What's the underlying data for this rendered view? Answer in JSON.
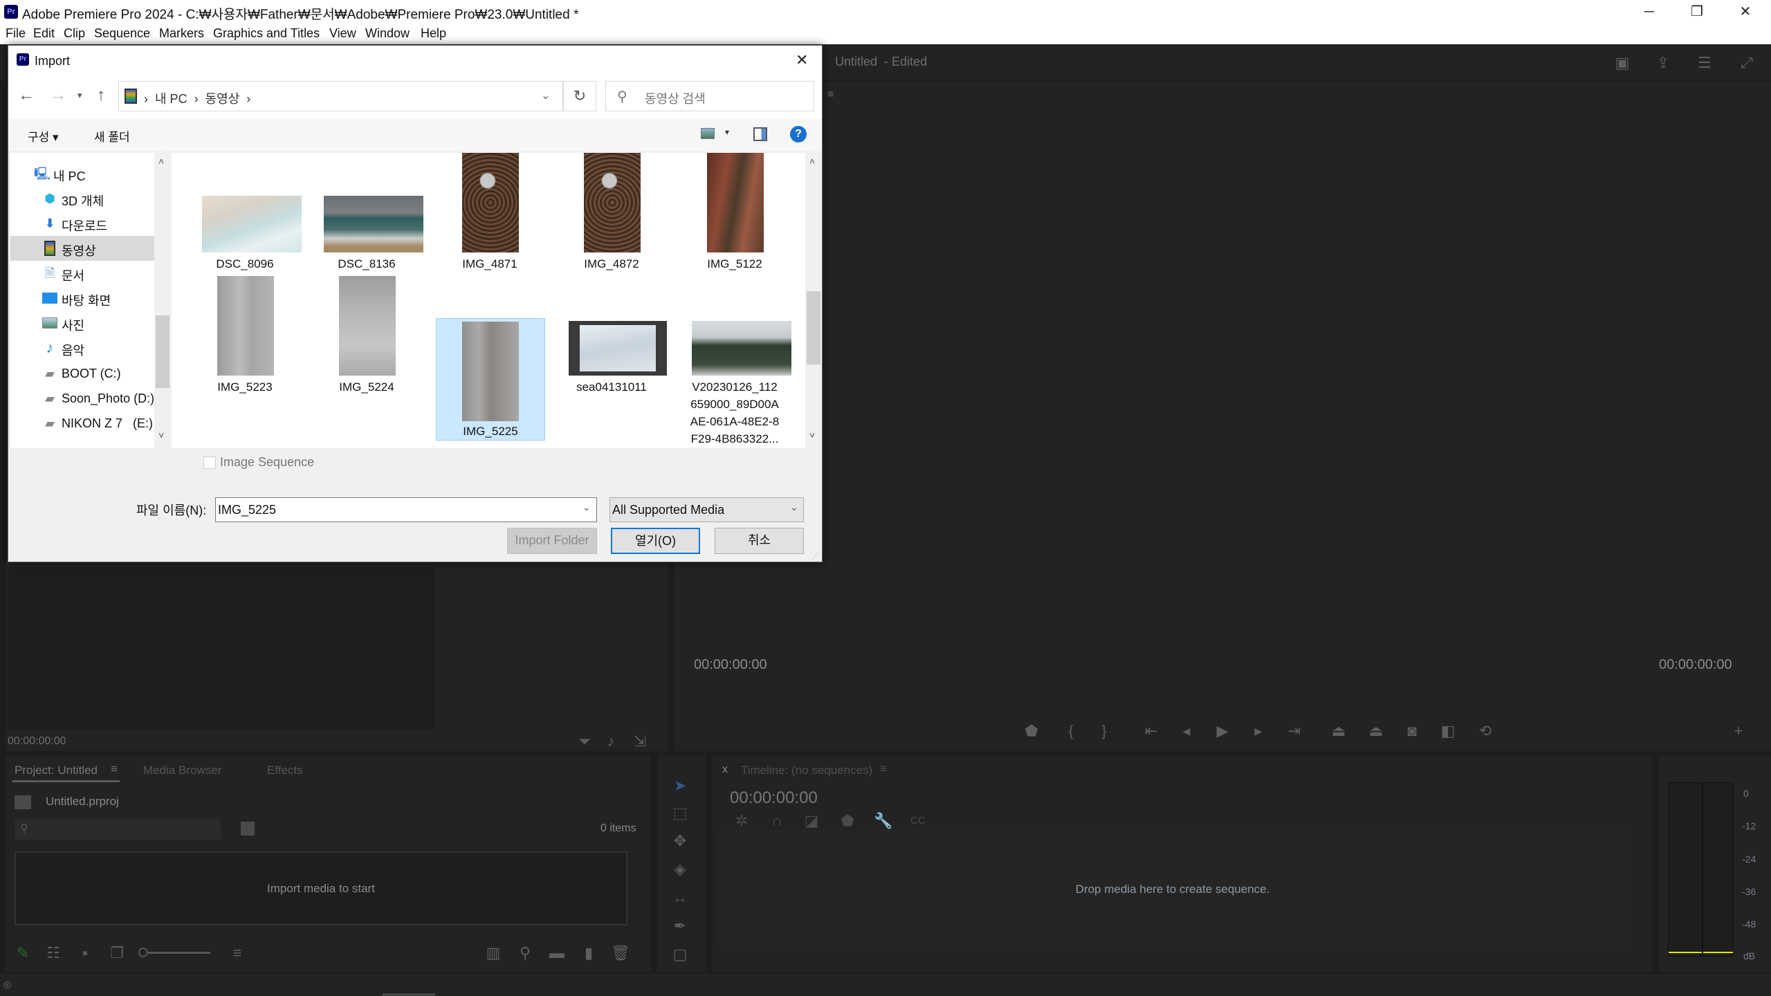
{
  "app": {
    "title": "Adobe Premiere Pro 2024 - C:₩사용자₩Father₩문서₩Adobe₩Premiere Pro₩23.0₩Untitled *",
    "logo": "Pr",
    "menu": [
      "File",
      "Edit",
      "Clip",
      "Sequence",
      "Markers",
      "Graphics and Titles",
      "View",
      "Window",
      "Help"
    ],
    "window_controls": {
      "minimize": "─",
      "maximize": "❐",
      "close": "✕"
    }
  },
  "header": {
    "project_title": "Untitled",
    "status": "- Edited"
  },
  "source_monitor": {
    "timecode": "00:00:00:00"
  },
  "program_monitor": {
    "timecode_left": "00:00:00:00",
    "timecode_right": "00:00:00:00"
  },
  "project_panel": {
    "tabs": [
      "Project: Untitled",
      "Media Browser",
      "Effects"
    ],
    "project_file": "Untitled.prproj",
    "item_count": "0 items",
    "empty_message": "Import media to start"
  },
  "timeline": {
    "tab_label": "Timeline: (no sequences)",
    "close": "x",
    "timecode": "00:00:00:00",
    "drop_message": "Drop media here to create sequence."
  },
  "audio_meter": {
    "labels": [
      "0",
      "-12",
      "-24",
      "-36",
      "-48",
      "dB"
    ],
    "accent": "#e5e500"
  },
  "dialog": {
    "title": "Import",
    "close": "✕",
    "breadcrumb": [
      "내 PC",
      "동영상"
    ],
    "search_placeholder": "동영상 검색",
    "toolbar": {
      "organize": "구성 ▾",
      "new_folder": "새 폴더"
    },
    "sidebar": [
      {
        "label": "내 PC",
        "icon": "computer-icon"
      },
      {
        "label": "3D 개체",
        "icon": "cube-icon"
      },
      {
        "label": "다운로드",
        "icon": "download-icon"
      },
      {
        "label": "동영상",
        "icon": "video-folder-icon",
        "selected": true
      },
      {
        "label": "문서",
        "icon": "document-icon"
      },
      {
        "label": "바탕 화면",
        "icon": "desktop-icon"
      },
      {
        "label": "사진",
        "icon": "pictures-icon"
      },
      {
        "label": "음악",
        "icon": "music-icon"
      },
      {
        "label": "BOOT (C:)",
        "icon": "drive-icon"
      },
      {
        "label": "Soon_Photo (D:)",
        "icon": "drive-icon"
      },
      {
        "label": "NIKON Z 7   (E:)",
        "icon": "drive-icon"
      }
    ],
    "files": [
      {
        "name": "DSC_8096"
      },
      {
        "name": "DSC_8136"
      },
      {
        "name": "IMG_4871"
      },
      {
        "name": "IMG_4872"
      },
      {
        "name": "IMG_5122"
      },
      {
        "name": "IMG_5223"
      },
      {
        "name": "IMG_5224"
      },
      {
        "name": "IMG_5225",
        "selected": true
      },
      {
        "name": "sea04131011"
      },
      {
        "name": "V20230126_112659000_89D00AAE-061A-48E2-8F29-4B863322...",
        "lines": [
          "V20230126_112",
          "659000_89D00A",
          "AE-061A-48E2-8",
          "F29-4B863322..."
        ]
      }
    ],
    "image_sequence_label": "Image Sequence",
    "image_sequence_checked": false,
    "filename_label": "파일 이름(N):",
    "filename_value": "IMG_5225",
    "filter_value": "All Supported Media",
    "buttons": {
      "import_folder": "Import Folder",
      "open": "열기(O)",
      "cancel": "취소"
    },
    "selection_color": "#cce8ff"
  }
}
